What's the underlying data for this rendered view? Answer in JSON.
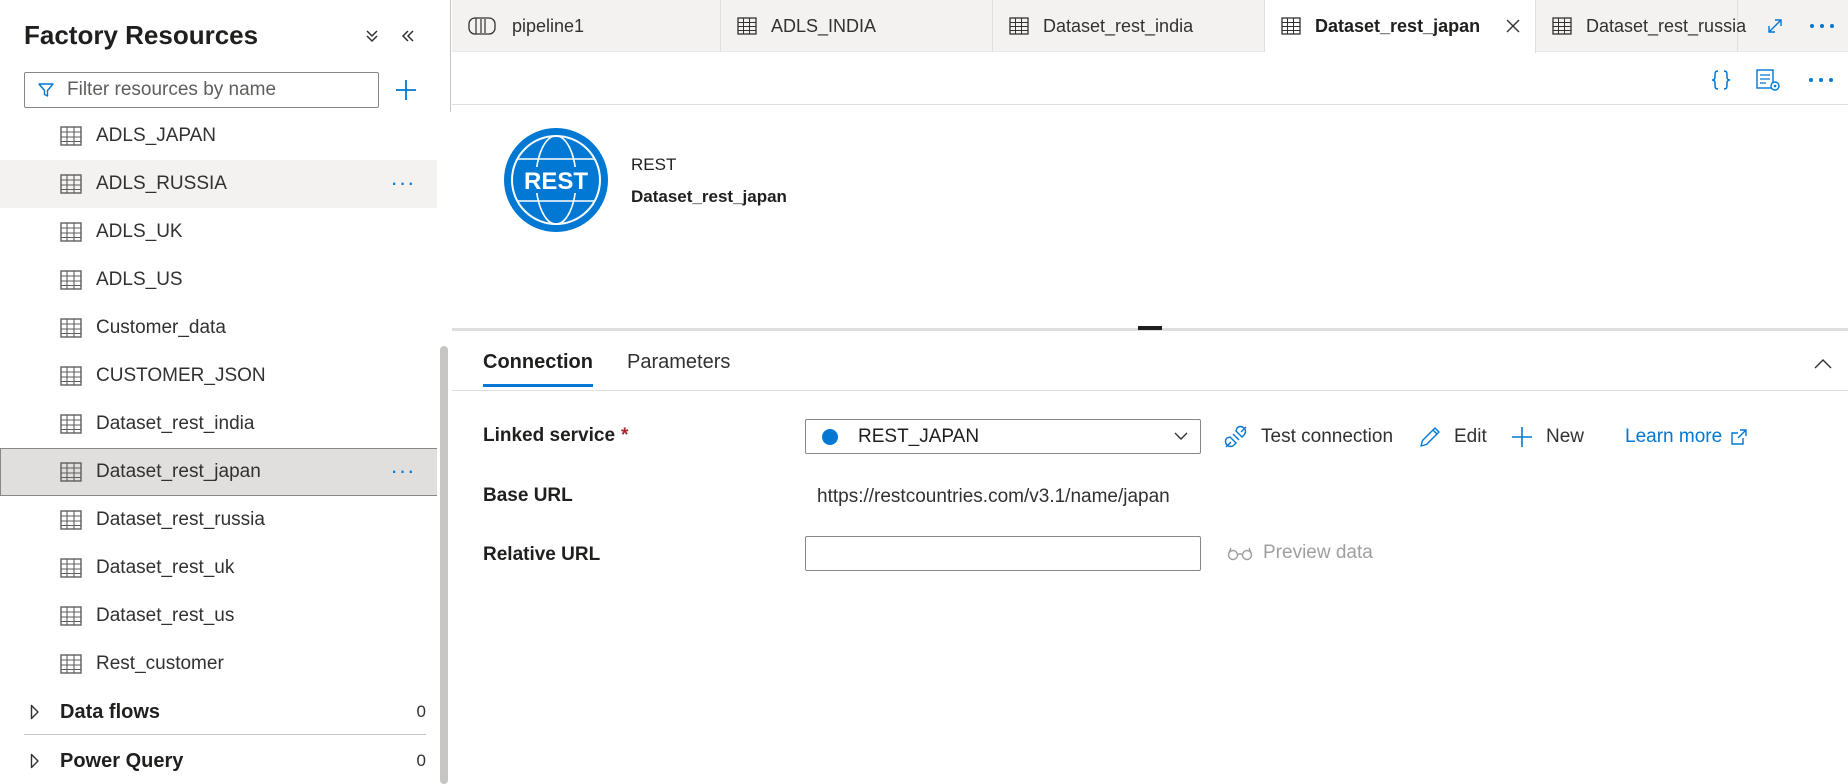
{
  "sidebar": {
    "title": "Factory Resources",
    "filter_placeholder": "Filter resources by name",
    "items": [
      {
        "label": "ADLS_JAPAN"
      },
      {
        "label": "ADLS_RUSSIA"
      },
      {
        "label": "ADLS_UK"
      },
      {
        "label": "ADLS_US"
      },
      {
        "label": "Customer_data"
      },
      {
        "label": "CUSTOMER_JSON"
      },
      {
        "label": "Dataset_rest_india"
      },
      {
        "label": "Dataset_rest_japan"
      },
      {
        "label": "Dataset_rest_russia"
      },
      {
        "label": "Dataset_rest_uk"
      },
      {
        "label": "Dataset_rest_us"
      },
      {
        "label": "Rest_customer"
      }
    ],
    "more_glyph": "···",
    "groups": [
      {
        "label": "Data flows",
        "count": "0"
      },
      {
        "label": "Power Query",
        "count": "0"
      }
    ]
  },
  "tabs": [
    {
      "label": "pipeline1",
      "icon": "pipeline-icon"
    },
    {
      "label": "ADLS_INDIA",
      "icon": "table-icon"
    },
    {
      "label": "Dataset_rest_india",
      "icon": "table-icon"
    },
    {
      "label": "Dataset_rest_japan",
      "icon": "table-icon",
      "active": true
    },
    {
      "label": "Dataset_rest_russia",
      "icon": "table-icon"
    }
  ],
  "dataset": {
    "icon_text": "REST",
    "type": "REST",
    "name": "Dataset_rest_japan"
  },
  "inner_tabs": {
    "connection": "Connection",
    "parameters": "Parameters"
  },
  "form": {
    "linked_service_label": "Linked service",
    "required_mark": "*",
    "linked_service_value": "REST_JAPAN",
    "test_connection": "Test connection",
    "edit": "Edit",
    "new": "New",
    "learn_more": "Learn more",
    "base_url_label": "Base URL",
    "base_url_value": "https://restcountries.com/v3.1/name/japan",
    "relative_url_label": "Relative URL",
    "relative_url_value": "",
    "preview_data": "Preview data"
  },
  "colors": {
    "accent": "#0078d4",
    "selected_row": "#e1dfdd",
    "required": "#a4262c"
  }
}
